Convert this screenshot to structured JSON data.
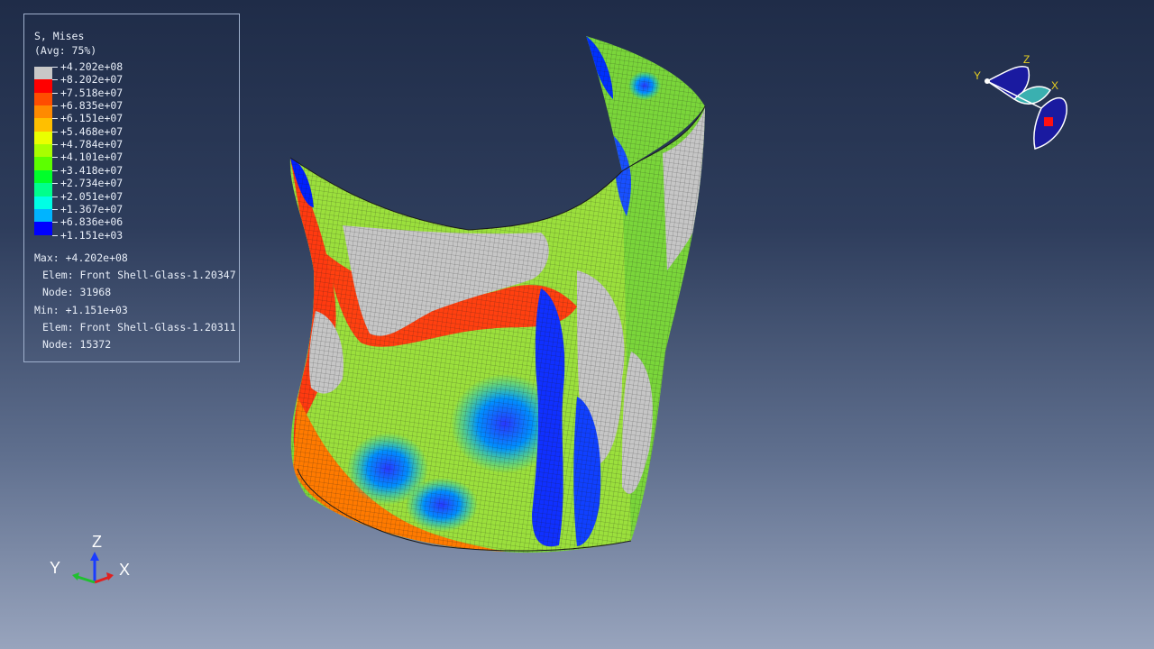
{
  "legend": {
    "title": "S, Mises",
    "subtitle": "(Avg: 75%)",
    "scale": [
      {
        "value": "+4.202e+08",
        "color": "#c8c8c8"
      },
      {
        "value": "+8.202e+07",
        "color": "#ff0000"
      },
      {
        "value": "+7.518e+07",
        "color": "#ff4d00"
      },
      {
        "value": "+6.835e+07",
        "color": "#ff8a00"
      },
      {
        "value": "+6.151e+07",
        "color": "#ffbf00"
      },
      {
        "value": "+5.468e+07",
        "color": "#eaff00"
      },
      {
        "value": "+4.784e+07",
        "color": "#a8ff00"
      },
      {
        "value": "+4.101e+07",
        "color": "#5cff00"
      },
      {
        "value": "+3.418e+07",
        "color": "#00ff2a"
      },
      {
        "value": "+2.734e+07",
        "color": "#00ff8c"
      },
      {
        "value": "+2.051e+07",
        "color": "#00ffe5"
      },
      {
        "value": "+1.367e+07",
        "color": "#00b4ff"
      },
      {
        "value": "+6.836e+06",
        "color": "#0064ff"
      },
      {
        "value": "+1.151e+03",
        "color": "#0000ff"
      }
    ],
    "max_line": "Max: +4.202e+08",
    "max_elem": "Elem: Front Shell-Glass-1.20347",
    "max_node": "Node: 31968",
    "min_line": "Min: +1.151e+03",
    "min_elem": "Elem: Front Shell-Glass-1.20311",
    "min_node": "Node: 15372"
  },
  "triad": {
    "z": "Z",
    "y": "Y",
    "x": "X"
  },
  "view_cube": {
    "y": "Y",
    "z": "Z",
    "x": "X"
  }
}
